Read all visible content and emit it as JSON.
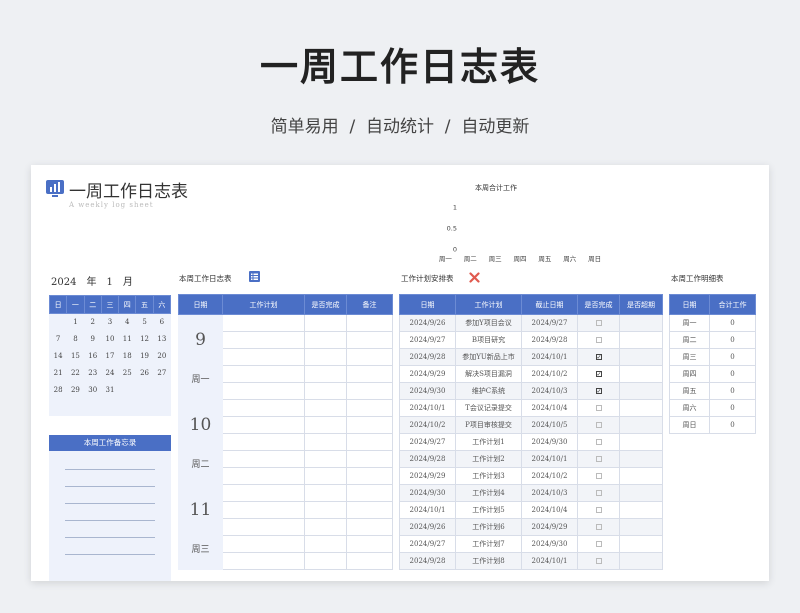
{
  "hero": {
    "title": "一周工作日志表",
    "subtitle": "简单易用  /  自动统计  /  自动更新"
  },
  "sheet": {
    "title": "一周工作日志表",
    "subtitle": "A weekly log sheet"
  },
  "chart_data": {
    "type": "bar",
    "title": "本周合计工作",
    "categories": [
      "周一",
      "周二",
      "周三",
      "周四",
      "周五",
      "周六",
      "周日"
    ],
    "values": [
      0,
      0,
      0,
      0,
      0,
      0,
      0
    ],
    "ylim": [
      0,
      1
    ],
    "yticks": [
      "1",
      "0.5",
      "0"
    ],
    "xlabel": "",
    "ylabel": ""
  },
  "calendar": {
    "year": "2024",
    "year_unit": "年",
    "month": "1",
    "month_unit": "月",
    "weekdays": [
      "日",
      "一",
      "二",
      "三",
      "四",
      "五",
      "六"
    ],
    "weeks": [
      [
        "",
        "1",
        "2",
        "3",
        "4",
        "5",
        "6"
      ],
      [
        "7",
        "8",
        "9",
        "10",
        "11",
        "12",
        "13"
      ],
      [
        "14",
        "15",
        "16",
        "17",
        "18",
        "19",
        "20"
      ],
      [
        "21",
        "22",
        "23",
        "24",
        "25",
        "26",
        "27"
      ],
      [
        "28",
        "29",
        "30",
        "31",
        "",
        "",
        ""
      ],
      [
        "",
        "",
        "",
        "",
        "",
        "",
        ""
      ]
    ]
  },
  "memo": {
    "title": "本周工作备忘录"
  },
  "log": {
    "title": "本周工作日志表",
    "icon": "list-icon",
    "headers": [
      "日期",
      "工作计划",
      "是否完成",
      "备注"
    ],
    "days": [
      {
        "num": "9",
        "weekday": "周一"
      },
      {
        "num": "10",
        "weekday": "周二"
      },
      {
        "num": "11",
        "weekday": "周三"
      }
    ]
  },
  "plan": {
    "title": "工作计划安排表",
    "icon": "cross-icon",
    "headers": [
      "日期",
      "工作计划",
      "截止日期",
      "是否完成",
      "是否超期"
    ],
    "rows": [
      [
        "2024/9/26",
        "参加Y项目会议",
        "2024/9/27",
        "☐"
      ],
      [
        "2024/9/27",
        "B项目研究",
        "2024/9/28",
        "☐"
      ],
      [
        "2024/9/28",
        "参加YU新品上市",
        "2024/10/1",
        "☑"
      ],
      [
        "2024/9/29",
        "解决S项目漏洞",
        "2024/10/2",
        "☑"
      ],
      [
        "2024/9/30",
        "维护C系统",
        "2024/10/3",
        "☑"
      ],
      [
        "2024/10/1",
        "T会议记录提交",
        "2024/10/4",
        "☐"
      ],
      [
        "2024/10/2",
        "P项目审核提交",
        "2024/10/5",
        "☐"
      ],
      [
        "2024/9/27",
        "工作计划1",
        "2024/9/30",
        "☐"
      ],
      [
        "2024/9/28",
        "工作计划2",
        "2024/10/1",
        "☐"
      ],
      [
        "2024/9/29",
        "工作计划3",
        "2024/10/2",
        "☐"
      ],
      [
        "2024/9/30",
        "工作计划4",
        "2024/10/3",
        "☐"
      ],
      [
        "2024/10/1",
        "工作计划5",
        "2024/10/4",
        "☐"
      ],
      [
        "2024/9/26",
        "工作计划6",
        "2024/9/29",
        "☐"
      ],
      [
        "2024/9/27",
        "工作计划7",
        "2024/9/30",
        "☐"
      ],
      [
        "2024/9/28",
        "工作计划8",
        "2024/10/1",
        "☐"
      ]
    ]
  },
  "detail": {
    "title": "本周工作明细表",
    "headers": [
      "日期",
      "合计工作"
    ],
    "rows": [
      [
        "周一",
        "0"
      ],
      [
        "周二",
        "0"
      ],
      [
        "周三",
        "0"
      ],
      [
        "周四",
        "0"
      ],
      [
        "周五",
        "0"
      ],
      [
        "周六",
        "0"
      ],
      [
        "周日",
        "0"
      ]
    ]
  },
  "colors": {
    "accent": "#4a6fc5",
    "light": "#eef2fb"
  }
}
